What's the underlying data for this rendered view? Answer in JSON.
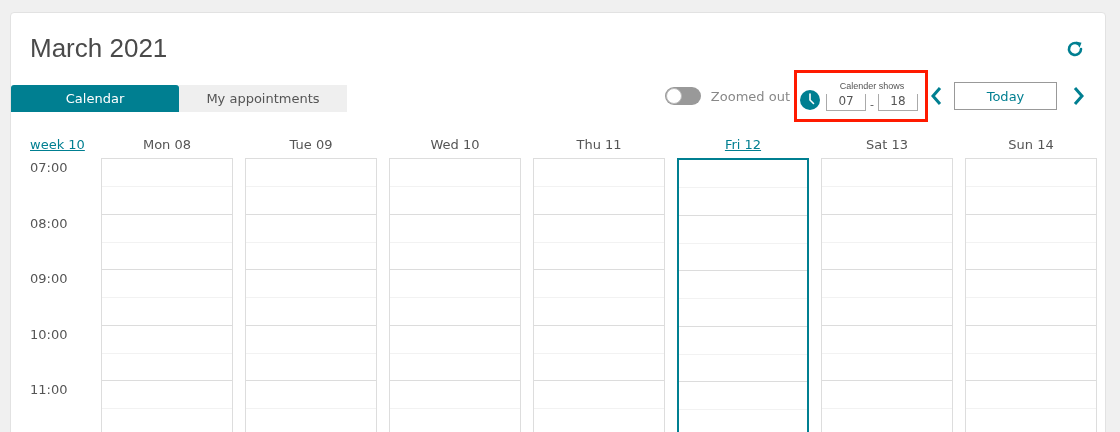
{
  "title": "March 2021",
  "tabs": [
    {
      "label": "Calendar",
      "selected": true
    },
    {
      "label": "My appointments",
      "selected": false
    }
  ],
  "zoom_toggle": {
    "label": "Zoomed out",
    "on": false
  },
  "hours_range": {
    "label": "Calender shows",
    "from": "07",
    "to": "18",
    "separator": "-",
    "highlighted": true
  },
  "today_button": "Today",
  "week": "week 10",
  "days": [
    {
      "label": "Mon 08",
      "selected": false
    },
    {
      "label": "Tue 09",
      "selected": false
    },
    {
      "label": "Wed 10",
      "selected": false
    },
    {
      "label": "Thu 11",
      "selected": false
    },
    {
      "label": "Fri 12",
      "selected": true
    },
    {
      "label": "Sat 13",
      "selected": false
    },
    {
      "label": "Sun 14",
      "selected": false
    }
  ],
  "times": [
    "07:00",
    "08:00",
    "09:00",
    "10:00",
    "11:00"
  ]
}
